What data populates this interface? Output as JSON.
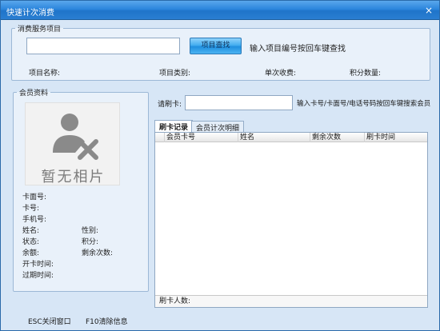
{
  "window": {
    "title": "快速计次消费",
    "close_label": "×"
  },
  "service_group": {
    "legend": "消费服务项目",
    "search_button": "项目查找",
    "search_hint": "输入项目编号按回车键查找",
    "item_name_label": "项目名称:",
    "item_category_label": "项目类别:",
    "unit_charge_label": "单次收费:",
    "points_label": "积分数量:"
  },
  "member_group": {
    "legend": "会员资料",
    "photo_placeholder": "暂无相片",
    "fields": {
      "card_face_no": "卡面号:",
      "card_no": "卡号:",
      "phone": "手机号:",
      "name": "姓名:",
      "gender": "性别:",
      "status": "状态:",
      "points": "积分:",
      "balance": "余额:",
      "remaining_times": "剩余次数:",
      "card_open_time": "开卡时间:",
      "expire_time": "过期时间:"
    }
  },
  "swipe": {
    "label": "请刷卡:",
    "hint": "输入卡号/卡面号/电话号码按回车键搜索会员"
  },
  "tabs": [
    {
      "label": "刷卡记录",
      "active": true
    },
    {
      "label": "会员计次明细",
      "active": false
    }
  ],
  "grid": {
    "columns": [
      "会员卡号",
      "姓名",
      "剩余次数",
      "刷卡时间"
    ],
    "footer_label": "刷卡人数:"
  },
  "statusbar": {
    "esc_hint": "ESC关闭窗口",
    "f10_hint": "F10清除信息"
  },
  "colors": {
    "titlebar": "#2c86dd",
    "window_bg": "#d7e6f6",
    "button": "#44aef0"
  }
}
